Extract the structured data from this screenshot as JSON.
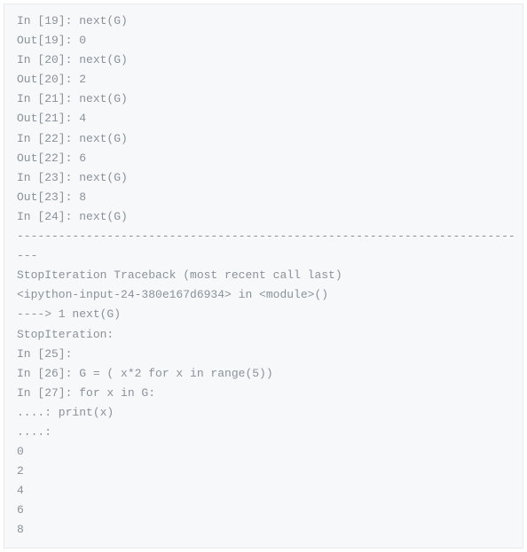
{
  "lines": [
    "In [19]: next(G)",
    "Out[19]: 0",
    "In [20]: next(G)",
    "Out[20]: 2",
    "In [21]: next(G)",
    "Out[21]: 4",
    "In [22]: next(G)",
    "Out[22]: 6",
    "In [23]: next(G)",
    "Out[23]: 8",
    "In [24]: next(G)",
    "------------------------------------------------------------------------",
    "---",
    "StopIteration Traceback (most recent call last)",
    "<ipython-input-24-380e167d6934> in <module>()",
    "----> 1 next(G)",
    "StopIteration:",
    "In [25]:",
    "In [26]: G = ( x*2 for x in range(5))",
    "In [27]: for x in G:",
    "....: print(x)",
    "....:",
    "0",
    "2",
    "4",
    "6",
    "8"
  ]
}
